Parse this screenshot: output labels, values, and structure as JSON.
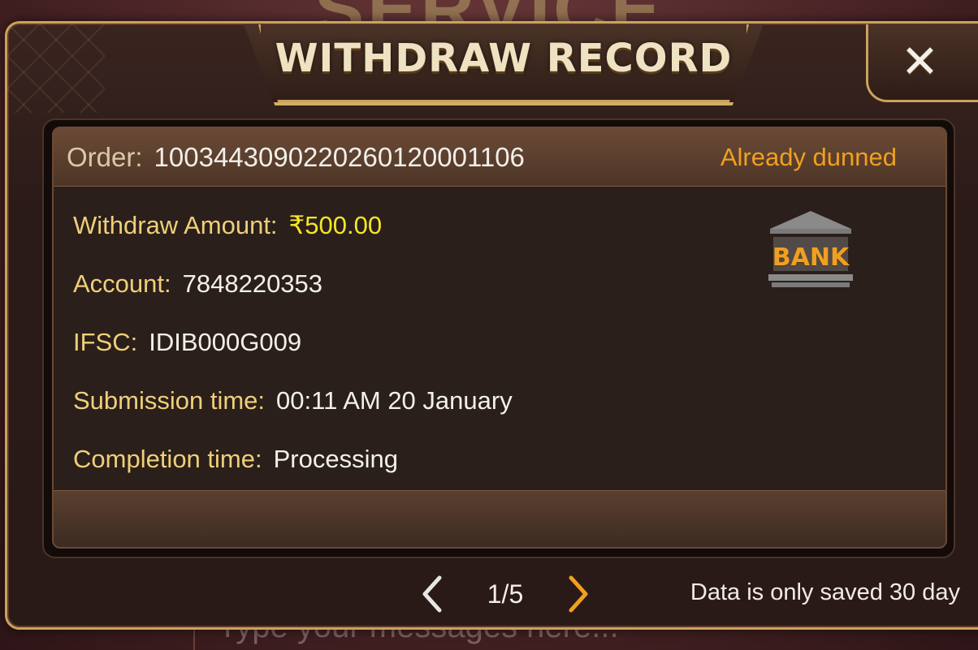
{
  "background": {
    "heading": "SERVICE",
    "input_placeholder": "Type your messages here..."
  },
  "modal": {
    "title": "WITHDRAW RECORD",
    "close_icon": "close-x-icon"
  },
  "record": {
    "order_label": "Order:",
    "order_number": "100344309022026012000110 6",
    "status": "Already dunned",
    "method_icon": "bank-icon",
    "method_label": "BANK",
    "fields": [
      {
        "label": "Withdraw Amount:",
        "value": "₹500.00"
      },
      {
        "label": "Account:",
        "value": "7848220353"
      },
      {
        "label": "IFSC:",
        "value": "IDIB000G009"
      },
      {
        "label": "Submission time:",
        "value": "00:11 AM 20 January"
      },
      {
        "label": "Completion time:",
        "value": "Processing"
      }
    ]
  },
  "pagination": {
    "label": "1/5",
    "prev_icon": "chevron-left-icon",
    "next_icon": "chevron-right-icon"
  },
  "footer_note": "Data is only saved 30 day",
  "colors": {
    "accent_gold": "#efcf79",
    "status_orange": "#f0a020",
    "amount_yellow": "#f5e625",
    "frame_gold": "#c9a25c"
  }
}
